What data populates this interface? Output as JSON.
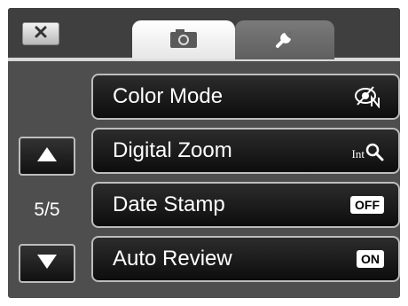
{
  "header": {
    "close_icon": "close-icon",
    "tabs": [
      {
        "name": "camera",
        "icon": "camera-icon",
        "selected": true
      },
      {
        "name": "settings",
        "icon": "wrench-icon",
        "selected": false
      }
    ]
  },
  "sidebar": {
    "page_indicator": "5/5",
    "up_icon": "triangle-up-icon",
    "down_icon": "triangle-down-icon"
  },
  "menu": {
    "items": [
      {
        "label": "Color Mode",
        "icon": "color-mode-icon",
        "badge": ""
      },
      {
        "label": "Digital Zoom",
        "icon": "intelligent-zoom-icon",
        "badge": "Int"
      },
      {
        "label": "Date Stamp",
        "icon": "badge",
        "badge": "OFF"
      },
      {
        "label": "Auto Review",
        "icon": "badge",
        "badge": "ON"
      }
    ]
  },
  "colors": {
    "background": "#4e4e4e",
    "item_border": "#bdbdbd",
    "text": "#ffffff"
  }
}
